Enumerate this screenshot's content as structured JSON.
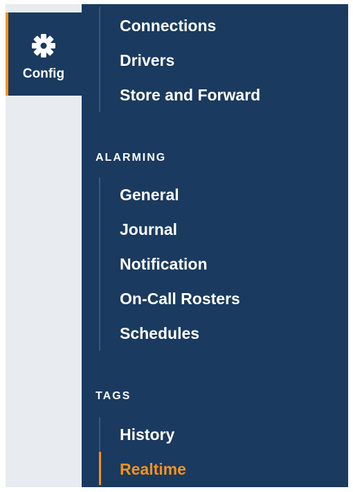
{
  "colors": {
    "panel_bg": "#1a3a5f",
    "rail_bg": "#e8ecf0",
    "accent": "#f7931e",
    "text": "#ffffff"
  },
  "rail": {
    "items": [
      {
        "label": "Config",
        "icon": "gear-icon",
        "active": true
      }
    ]
  },
  "menu": {
    "top_items": [
      "Connections",
      "Drivers",
      "Store and Forward"
    ],
    "sections": [
      {
        "title": "ALARMING",
        "items": [
          "General",
          "Journal",
          "Notification",
          "On-Call Rosters",
          "Schedules"
        ]
      },
      {
        "title": "TAGS",
        "items": [
          "History",
          "Realtime"
        ],
        "active_item": "Realtime"
      }
    ]
  }
}
